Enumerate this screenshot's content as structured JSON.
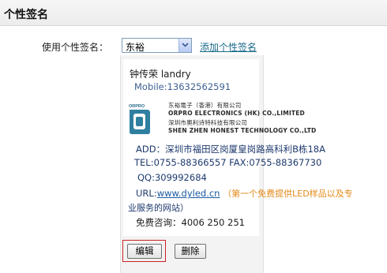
{
  "page": {
    "title": "个性签名"
  },
  "signature_row": {
    "label": "使用个性签名：",
    "select_value": "东裕",
    "add_link": "添加个性签名"
  },
  "signature": {
    "name_line": "钟传荣  landry",
    "mobile": "Mobile:13632562591",
    "company_line1": "东裕電子（香港）有限公司",
    "company_line2": "ORPRO  ELECTRONICS (HK) CO.,LIMITED",
    "company_line3": "深圳市奧利诗特科技有限公司",
    "company_line4": "SHEN ZHEN HONEST TECHNOLOGY CO.,LTD",
    "logo_text": "ORPRO",
    "address": "ADD：深圳市福田区岗厦皇岗路高科利B栋18A",
    "tel_fax": "TEL:0755-88366557   FAX:0755-88367730",
    "qq": "QQ:309992684",
    "url_label": "URL:",
    "url": "www.dyled.cn",
    "url_note_line1": "（第一个免费提供LED样品以及专",
    "url_note_line2": "业服务的网站）",
    "hotline": "免费咨询：4006 250 251"
  },
  "buttons": {
    "edit": "编辑",
    "delete": "删除"
  },
  "colors": {
    "link": "#1a5aa0",
    "note": "#e38a1a",
    "highlight": "#cc2222"
  }
}
